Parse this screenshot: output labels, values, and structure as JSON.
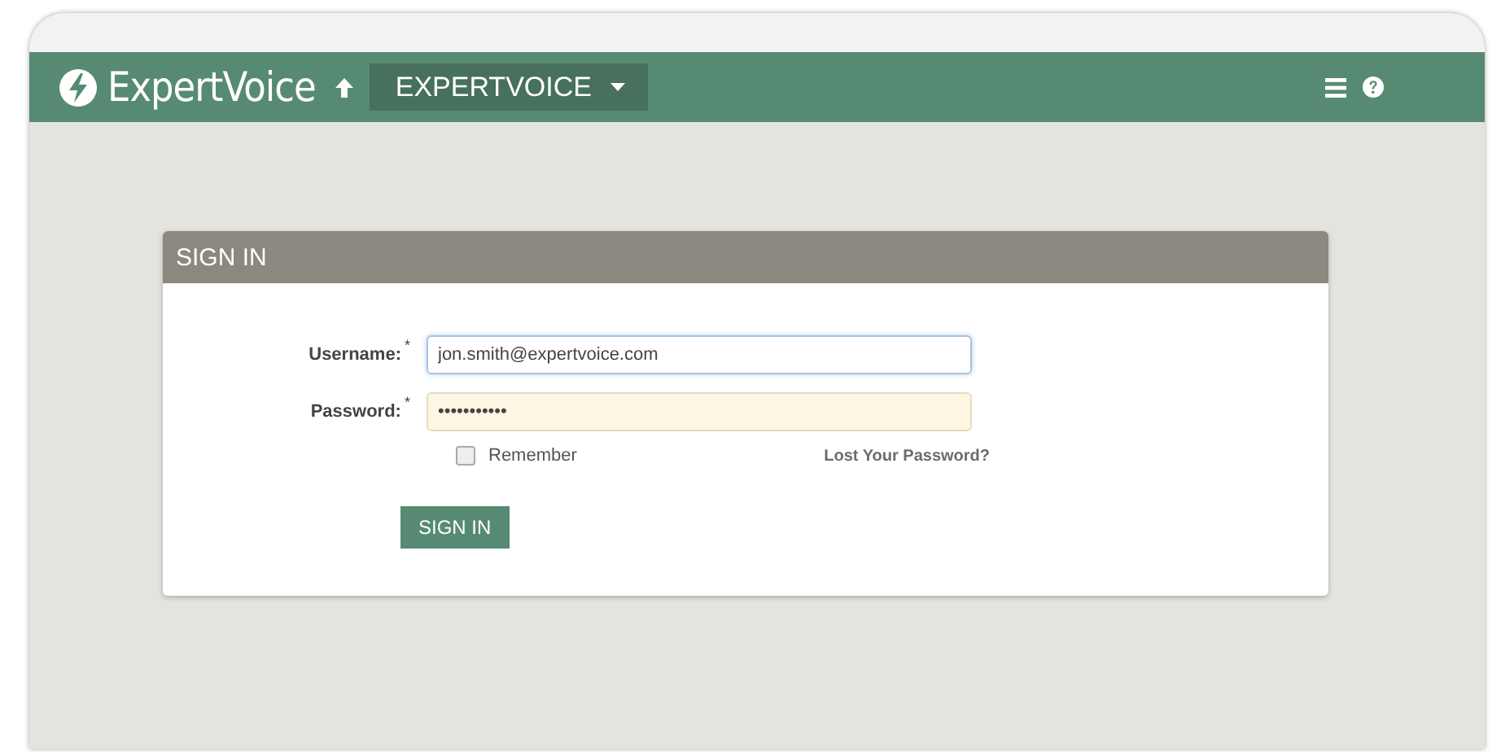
{
  "header": {
    "brand": "ExpertVoice",
    "org_selector": "EXPERTVOICE"
  },
  "signin": {
    "title": "SIGN IN",
    "fields": [
      {
        "label": "Username:",
        "required_mark": "*",
        "value": "jon.smith@expertvoice.com",
        "focused": true
      },
      {
        "label": "Password:",
        "required_mark": "*",
        "value": "•••••••••••",
        "focused": false
      }
    ],
    "remember": {
      "label": "Remember",
      "checked": false
    },
    "lost_password_link": "Lost Your Password?",
    "submit_button": "SIGN IN"
  }
}
